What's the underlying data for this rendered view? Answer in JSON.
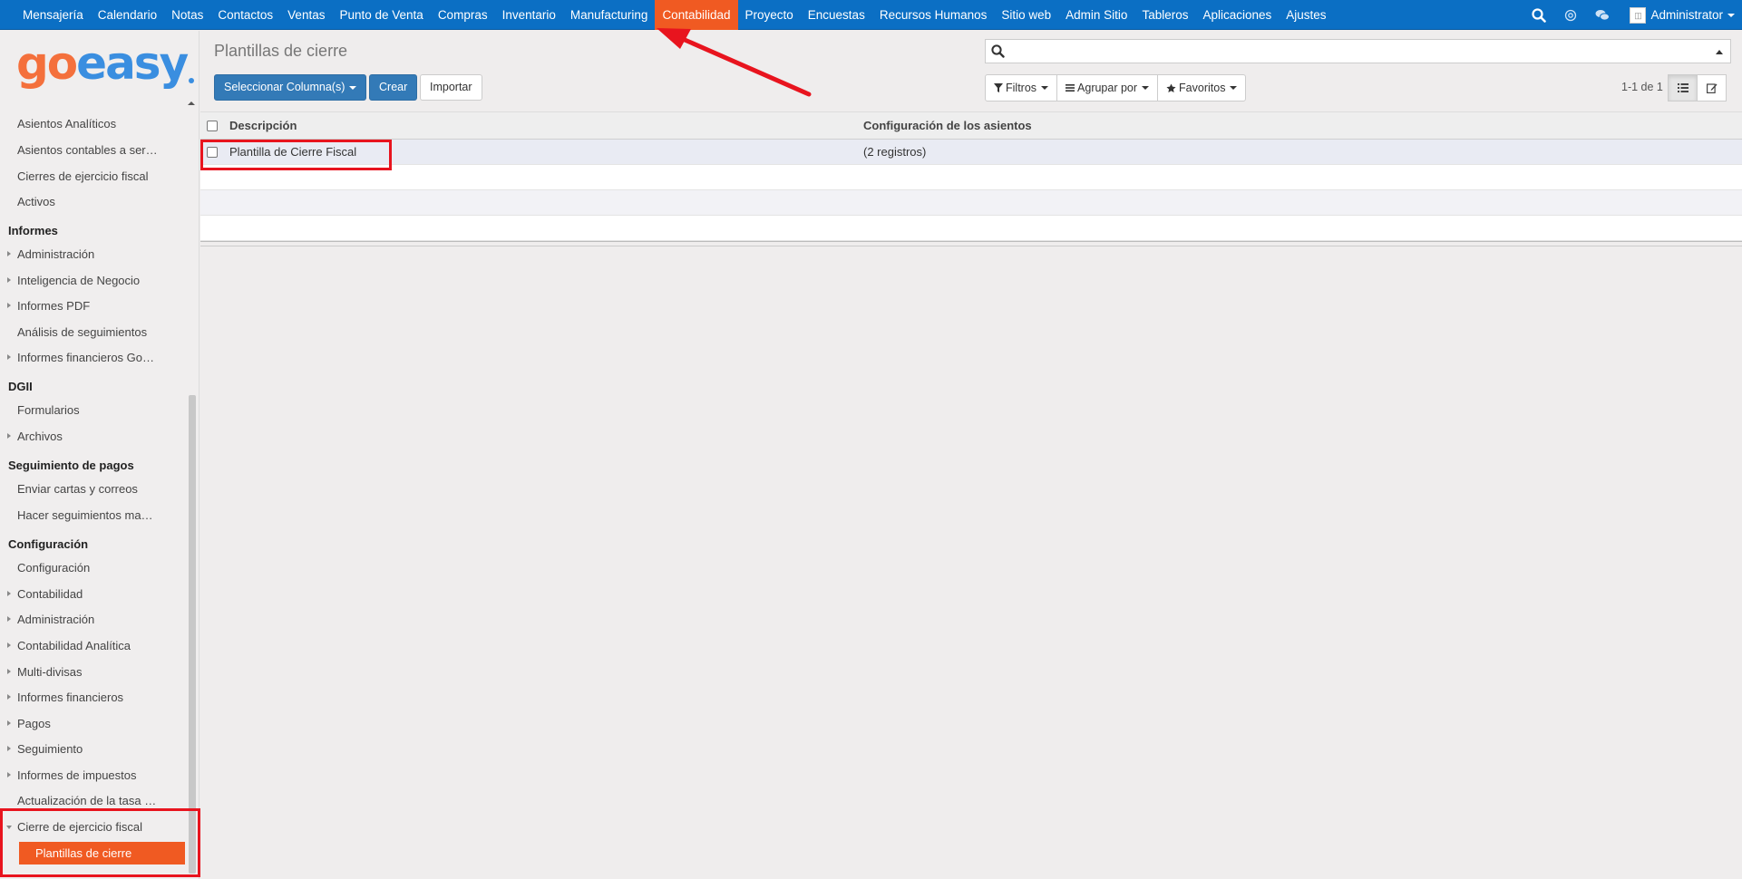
{
  "topnav": {
    "items": [
      "Mensajería",
      "Calendario",
      "Notas",
      "Contactos",
      "Ventas",
      "Punto de Venta",
      "Compras",
      "Inventario",
      "Manufacturing",
      "Contabilidad",
      "Proyecto",
      "Encuestas",
      "Recursos Humanos",
      "Sitio web",
      "Admin Sitio",
      "Tableros",
      "Aplicaciones",
      "Ajustes"
    ],
    "active": "Contabilidad",
    "user": "Administrator",
    "colors": {
      "bar": "#0b6fc4",
      "active": "#f05a22"
    }
  },
  "logo": {
    "part1": "go",
    "part2": "easy"
  },
  "sidebar": {
    "top_items": [
      "Asientos Analíticos",
      "Asientos contables a ser…",
      "Cierres de ejercicio fiscal",
      "Activos"
    ],
    "sections": [
      {
        "title": "Informes",
        "items": [
          "Administración",
          "Inteligencia de Negocio",
          "Informes PDF",
          "Análisis de seguimientos",
          "Informes financieros Go…"
        ]
      },
      {
        "title": "DGII",
        "items": [
          "Formularios",
          "Archivos"
        ]
      },
      {
        "title": "Seguimiento de pagos",
        "items": [
          "Enviar cartas y correos",
          "Hacer seguimientos ma…"
        ]
      },
      {
        "title": "Configuración",
        "items": [
          "Configuración",
          "Contabilidad",
          "Administración",
          "Contabilidad Analítica",
          "Multi-divisas",
          "Informes financieros",
          "Pagos",
          "Seguimiento",
          "Informes de impuestos",
          "Actualización de la tasa …",
          "Cierre de ejercicio fiscal"
        ]
      }
    ],
    "active_sub": "Plantillas de cierre"
  },
  "page": {
    "title": "Plantillas de cierre",
    "buttons": {
      "columns": "Seleccionar Columna(s)",
      "create": "Crear",
      "import": "Importar"
    },
    "filters": {
      "filters": "Filtros",
      "group": "Agrupar por",
      "favorites": "Favoritos"
    },
    "pager": "1-1 de 1"
  },
  "table": {
    "headers": [
      "Descripción",
      "Configuración de los asientos"
    ],
    "rows": [
      {
        "description": "Plantilla de Cierre Fiscal",
        "config": "(2 registros)"
      }
    ]
  },
  "annotation_color": "#e8141e"
}
